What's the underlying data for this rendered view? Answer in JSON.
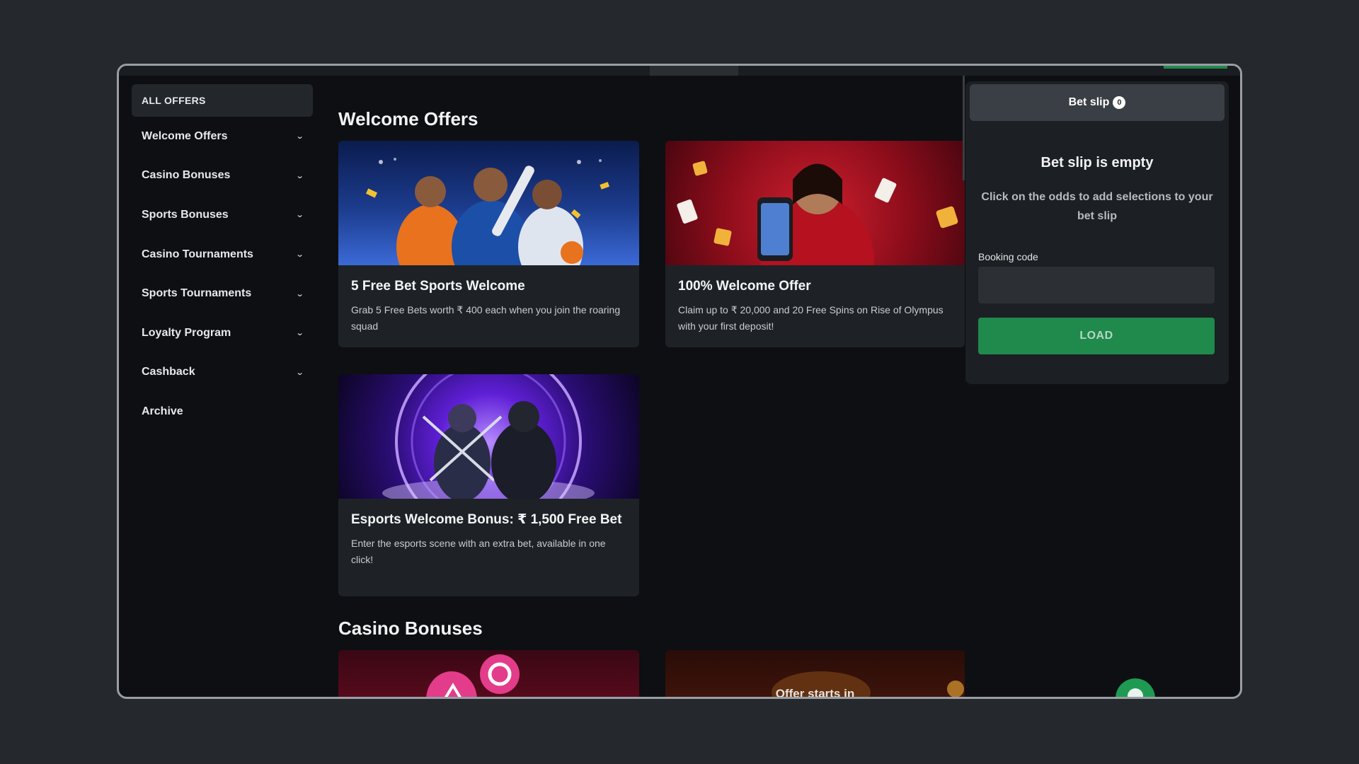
{
  "sidebar": {
    "all_offers": "ALL OFFERS",
    "items": [
      {
        "label": "Welcome Offers",
        "has_chevron": true
      },
      {
        "label": "Casino Bonuses",
        "has_chevron": true
      },
      {
        "label": "Sports Bonuses",
        "has_chevron": true
      },
      {
        "label": "Casino Tournaments",
        "has_chevron": true
      },
      {
        "label": "Sports Tournaments",
        "has_chevron": true
      },
      {
        "label": "Loyalty Program",
        "has_chevron": true
      },
      {
        "label": "Cashback",
        "has_chevron": true
      },
      {
        "label": "Archive",
        "has_chevron": false
      }
    ],
    "chevron_icon": "chevron-down-icon"
  },
  "main": {
    "welcome_title": "Welcome Offers",
    "casino_title": "Casino Bonuses",
    "cards": [
      {
        "title": "5 Free Bet Sports Welcome",
        "desc": "Grab 5 Free Bets worth ₹ 400 each when you join the roaring squad"
      },
      {
        "title": "100% Welcome Offer",
        "desc": "Claim up to ₹ 20,000 and 20 Free Spins on Rise of Olympus with your first deposit!"
      },
      {
        "title": "Esports Welcome Bonus: ₹ 1,500 Free Bet",
        "desc": "Enter the esports scene with an extra bet, available in one click!"
      }
    ],
    "casino_card_2_overlay": "Offer starts in"
  },
  "betslip": {
    "tab_label": "Bet slip",
    "count": "0",
    "empty_title": "Bet slip is empty",
    "empty_desc": "Click on the odds to add selections to your bet slip",
    "booking_label": "Booking code",
    "booking_value": "",
    "load_label": "LOAD"
  },
  "colors": {
    "accent_green": "#1f8a4c",
    "panel": "#1c1f23",
    "background": "#0d0f12"
  }
}
